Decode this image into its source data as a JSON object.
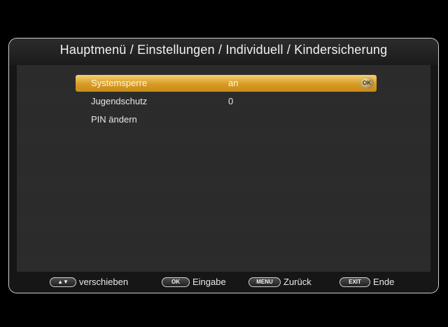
{
  "header": {
    "title": "Hauptmenü / Einstellungen / Individuell / Kindersicherung"
  },
  "menu": {
    "items": [
      {
        "label": "Systemsperre",
        "value": "an",
        "selected": true,
        "badge": "OK"
      },
      {
        "label": "Jugendschutz",
        "value": "0",
        "selected": false
      },
      {
        "label": "PIN ändern",
        "value": "",
        "selected": false
      }
    ]
  },
  "footer": {
    "hints": [
      {
        "key": "▲▼",
        "label": "verschieben"
      },
      {
        "key": "OK",
        "label": "Eingabe"
      },
      {
        "key": "MENU",
        "label": "Zurück"
      },
      {
        "key": "EXIT",
        "label": "Ende"
      }
    ]
  },
  "colors": {
    "highlight": "#e0a83a",
    "background": "#2a2a2a",
    "frame": "#cfcfcf"
  }
}
